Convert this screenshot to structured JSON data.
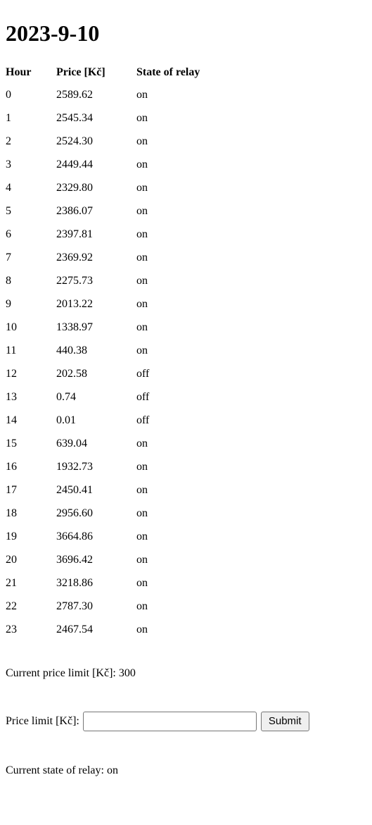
{
  "page": {
    "title": "2023-9-10"
  },
  "table": {
    "headers": {
      "hour": "Hour",
      "price": "Price [Kč]",
      "state": "State of relay"
    },
    "rows": [
      {
        "hour": "0",
        "price": "2589.62",
        "state": "on"
      },
      {
        "hour": "1",
        "price": "2545.34",
        "state": "on"
      },
      {
        "hour": "2",
        "price": "2524.30",
        "state": "on"
      },
      {
        "hour": "3",
        "price": "2449.44",
        "state": "on"
      },
      {
        "hour": "4",
        "price": "2329.80",
        "state": "on"
      },
      {
        "hour": "5",
        "price": "2386.07",
        "state": "on"
      },
      {
        "hour": "6",
        "price": "2397.81",
        "state": "on"
      },
      {
        "hour": "7",
        "price": "2369.92",
        "state": "on"
      },
      {
        "hour": "8",
        "price": "2275.73",
        "state": "on"
      },
      {
        "hour": "9",
        "price": "2013.22",
        "state": "on"
      },
      {
        "hour": "10",
        "price": "1338.97",
        "state": "on"
      },
      {
        "hour": "11",
        "price": "440.38",
        "state": "on"
      },
      {
        "hour": "12",
        "price": "202.58",
        "state": "off"
      },
      {
        "hour": "13",
        "price": "0.74",
        "state": "off"
      },
      {
        "hour": "14",
        "price": "0.01",
        "state": "off"
      },
      {
        "hour": "15",
        "price": "639.04",
        "state": "on"
      },
      {
        "hour": "16",
        "price": "1932.73",
        "state": "on"
      },
      {
        "hour": "17",
        "price": "2450.41",
        "state": "on"
      },
      {
        "hour": "18",
        "price": "2956.60",
        "state": "on"
      },
      {
        "hour": "19",
        "price": "3664.86",
        "state": "on"
      },
      {
        "hour": "20",
        "price": "3696.42",
        "state": "on"
      },
      {
        "hour": "21",
        "price": "3218.86",
        "state": "on"
      },
      {
        "hour": "22",
        "price": "2787.30",
        "state": "on"
      },
      {
        "hour": "23",
        "price": "2467.54",
        "state": "on"
      }
    ]
  },
  "current_price_limit": {
    "text": "Current price limit [Kč]: 300",
    "label": "Current price limit [Kč]:",
    "value": "300"
  },
  "form": {
    "label": "Price limit [Kč]:",
    "input_value": "",
    "input_placeholder": "",
    "submit_label": "Submit"
  },
  "current_relay_state": {
    "text": "Current state of relay: on",
    "label": "Current state of relay:",
    "value": "on"
  }
}
